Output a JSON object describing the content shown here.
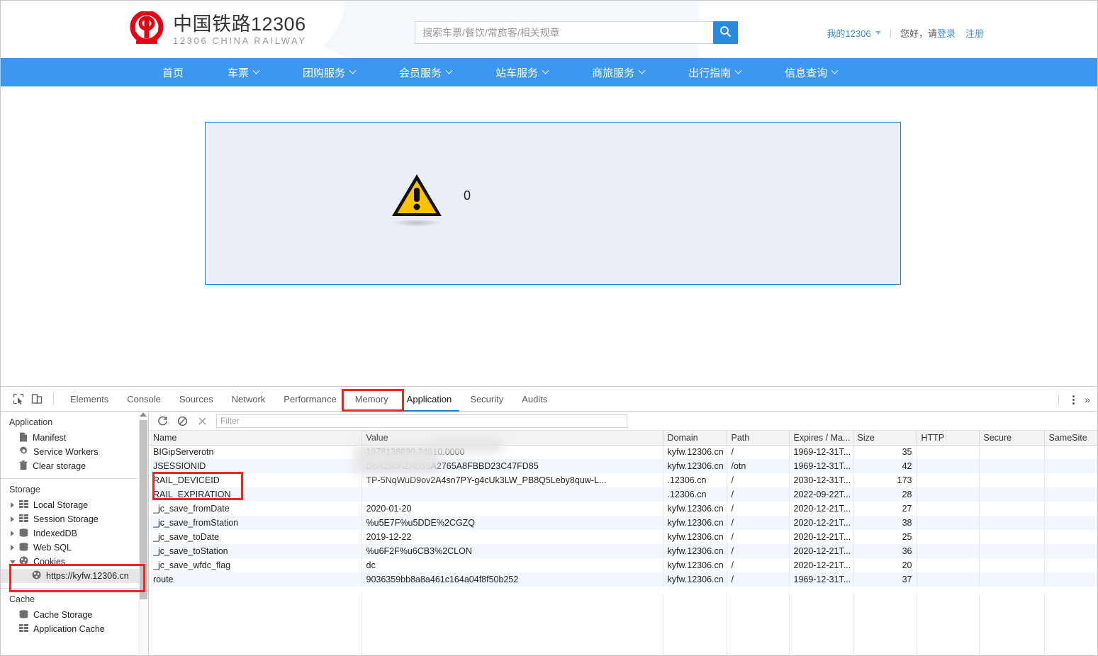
{
  "site": {
    "logo": {
      "icon": "china-railway-logo-icon",
      "title_cn": "中国铁路12306",
      "title_en": "12306 CHINA RAILWAY"
    },
    "search": {
      "placeholder": "搜索车票/餐饮/常旅客/相关规章",
      "value": "",
      "button_icon": "search-icon"
    },
    "account": {
      "my12306": "我的12306",
      "separator": "|",
      "greeting": "您好，请",
      "login": "登录",
      "register": "注册"
    },
    "nav": [
      {
        "label": "首页",
        "has_caret": false
      },
      {
        "label": "车票",
        "has_caret": true
      },
      {
        "label": "团购服务",
        "has_caret": true
      },
      {
        "label": "会员服务",
        "has_caret": true
      },
      {
        "label": "站车服务",
        "has_caret": true
      },
      {
        "label": "商旅服务",
        "has_caret": true
      },
      {
        "label": "出行指南",
        "has_caret": true
      },
      {
        "label": "信息查询",
        "has_caret": true
      }
    ],
    "content": {
      "warning_icon": "warning-triangle-icon",
      "message": "0"
    },
    "colors": {
      "brand_red": "#e02020",
      "nav_blue": "#3b97f0",
      "link_blue": "#3b8fdd",
      "box_bg": "#eaeef7",
      "box_border": "#2780c4"
    }
  },
  "devtools": {
    "left_icons": [
      {
        "name": "inspect-element-icon"
      },
      {
        "name": "device-toolbar-icon"
      }
    ],
    "tabs": [
      {
        "label": "Elements",
        "active": false
      },
      {
        "label": "Console",
        "active": false
      },
      {
        "label": "Sources",
        "active": false
      },
      {
        "label": "Network",
        "active": false
      },
      {
        "label": "Performance",
        "active": false
      },
      {
        "label": "Memory",
        "active": false
      },
      {
        "label": "Application",
        "active": true
      },
      {
        "label": "Security",
        "active": false
      },
      {
        "label": "Audits",
        "active": false
      }
    ],
    "right_icons": [
      {
        "name": "more-options-icon"
      },
      {
        "name": "overflow-chevron-icon",
        "glyph": "»"
      }
    ],
    "sidebar": {
      "sections": [
        {
          "title": "Application",
          "items": [
            {
              "label": "Manifest",
              "icon": "manifest-file-icon",
              "indent": 0,
              "arrow": "none",
              "selected": false
            },
            {
              "label": "Service Workers",
              "icon": "gear-icon",
              "indent": 0,
              "arrow": "none",
              "selected": false
            },
            {
              "label": "Clear storage",
              "icon": "trash-icon",
              "indent": 0,
              "arrow": "none",
              "selected": false
            }
          ]
        },
        {
          "title": "Storage",
          "items": [
            {
              "label": "Local Storage",
              "icon": "table-icon",
              "indent": 0,
              "arrow": "closed",
              "selected": false
            },
            {
              "label": "Session Storage",
              "icon": "table-icon",
              "indent": 0,
              "arrow": "closed",
              "selected": false
            },
            {
              "label": "IndexedDB",
              "icon": "database-icon",
              "indent": 0,
              "arrow": "closed",
              "selected": false
            },
            {
              "label": "Web SQL",
              "icon": "database-icon",
              "indent": 0,
              "arrow": "closed",
              "selected": false
            },
            {
              "label": "Cookies",
              "icon": "cookie-icon",
              "indent": 0,
              "arrow": "open",
              "selected": false
            },
            {
              "label": "https://kyfw.12306.cn",
              "icon": "cookie-icon",
              "indent": 1,
              "arrow": "none",
              "selected": true
            }
          ]
        },
        {
          "title": "Cache",
          "items": [
            {
              "label": "Cache Storage",
              "icon": "database-icon",
              "indent": 0,
              "arrow": "none",
              "selected": false
            },
            {
              "label": "Application Cache",
              "icon": "table-icon",
              "indent": 0,
              "arrow": "none",
              "selected": false
            }
          ]
        }
      ]
    },
    "cookies_panel": {
      "toolbar": {
        "refresh_icon": "refresh-icon",
        "clear_all_icon": "clear-all-cookies-icon",
        "delete_icon": "delete-selected-icon",
        "filter_placeholder": "Filter",
        "filter_value": ""
      },
      "columns": [
        "Name",
        "Value",
        "Domain",
        "Path",
        "Expires / Ma...",
        "Size",
        "HTTP",
        "Secure",
        "SameSite"
      ],
      "rows": [
        {
          "name": "BIGipServerotn",
          "value": "1978138890.24610.0000",
          "domain": "kyfw.12306.cn",
          "path": "/",
          "expires": "1969-12-31T...",
          "size": "35",
          "http": "",
          "secure": "",
          "samesite": ""
        },
        {
          "name": "JSESSIONID",
          "value": "D8A280A2AB55A2765A8FBBD23C47FD85",
          "domain": "kyfw.12306.cn",
          "path": "/otn",
          "expires": "1969-12-31T...",
          "size": "42",
          "http": "",
          "secure": "",
          "samesite": ""
        },
        {
          "name": "RAIL_DEVICEID",
          "value": "TP-5NqWuD9ov2A4sn7PY-g4cUk3LW_PB8Q5Leby8quw-L...",
          "domain": ".12306.cn",
          "path": "/",
          "expires": "2030-12-31T...",
          "size": "173",
          "http": "",
          "secure": "",
          "samesite": ""
        },
        {
          "name": "RAIL_EXPIRATION",
          "value": "",
          "domain": ".12306.cn",
          "path": "/",
          "expires": "2022-09-22T...",
          "size": "28",
          "http": "",
          "secure": "",
          "samesite": ""
        },
        {
          "name": "_jc_save_fromDate",
          "value": "2020-01-20",
          "domain": "kyfw.12306.cn",
          "path": "/",
          "expires": "2020-12-21T...",
          "size": "27",
          "http": "",
          "secure": "",
          "samesite": ""
        },
        {
          "name": "_jc_save_fromStation",
          "value": "%u5E7F%u5DDE%2CGZQ",
          "domain": "kyfw.12306.cn",
          "path": "/",
          "expires": "2020-12-21T...",
          "size": "38",
          "http": "",
          "secure": "",
          "samesite": ""
        },
        {
          "name": "_jc_save_toDate",
          "value": "2019-12-22",
          "domain": "kyfw.12306.cn",
          "path": "/",
          "expires": "2020-12-21T...",
          "size": "25",
          "http": "",
          "secure": "",
          "samesite": ""
        },
        {
          "name": "_jc_save_toStation",
          "value": "%u6F2F%u6CB3%2CLON",
          "domain": "kyfw.12306.cn",
          "path": "/",
          "expires": "2020-12-21T...",
          "size": "36",
          "http": "",
          "secure": "",
          "samesite": ""
        },
        {
          "name": "_jc_save_wfdc_flag",
          "value": "dc",
          "domain": "kyfw.12306.cn",
          "path": "/",
          "expires": "2020-12-21T...",
          "size": "20",
          "http": "",
          "secure": "",
          "samesite": ""
        },
        {
          "name": "route",
          "value": "9036359bb8a8a461c164a04f8f50b252",
          "domain": "kyfw.12306.cn",
          "path": "/",
          "expires": "1969-12-31T...",
          "size": "37",
          "http": "",
          "secure": "",
          "samesite": ""
        }
      ]
    },
    "annotations": [
      {
        "name": "application-tab-highlight",
        "color": "#f22424"
      },
      {
        "name": "cookies-sidebar-highlight",
        "color": "#f22424"
      },
      {
        "name": "rail-cookies-highlight",
        "color": "#f22424"
      }
    ]
  }
}
